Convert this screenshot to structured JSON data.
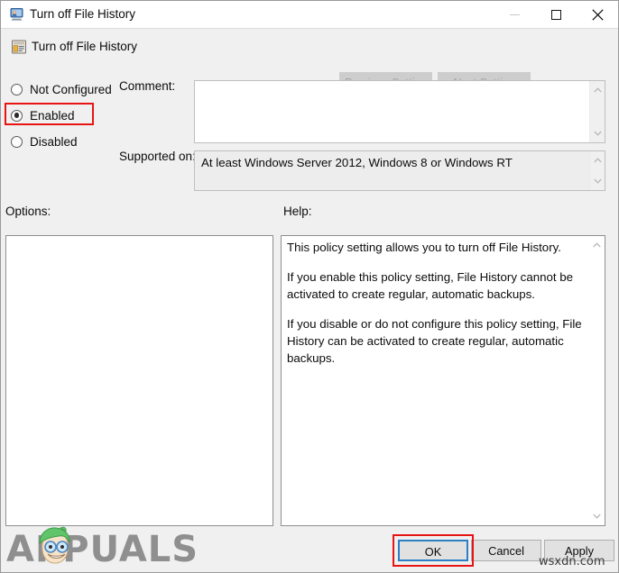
{
  "window": {
    "title": "Turn off File History",
    "icon": "policy-monitor-icon",
    "controls": {
      "minimize": "minimize-icon",
      "maximize": "maximize-icon",
      "close": "close-icon"
    }
  },
  "header": {
    "title": "Turn off File History",
    "icon": "group-policy-setting-icon",
    "previous_setting_label": "Previous Setting",
    "next_setting_label": "Next Setting",
    "previous_setting_enabled": false,
    "next_setting_enabled": false
  },
  "state_options": {
    "selected": "Enabled",
    "items": [
      {
        "label": "Not Configured",
        "checked": false
      },
      {
        "label": "Enabled",
        "checked": true
      },
      {
        "label": "Disabled",
        "checked": false
      }
    ]
  },
  "comment": {
    "label": "Comment:",
    "value": "",
    "placeholder": ""
  },
  "supported_on": {
    "label": "Supported on:",
    "value": "At least Windows Server 2012, Windows 8 or Windows RT"
  },
  "options": {
    "label": "Options:",
    "items": []
  },
  "help": {
    "label": "Help:",
    "paragraphs": [
      "This policy setting allows you to turn off File History.",
      "If you enable this policy setting, File History cannot be activated to create regular, automatic backups.",
      "If you disable or do not configure this policy setting, File History can be activated to create regular, automatic backups."
    ]
  },
  "footer": {
    "ok_label": "OK",
    "cancel_label": "Cancel",
    "apply_label": "Apply"
  },
  "annotations": {
    "color": "#e81414",
    "targets": [
      "Enabled",
      "OK"
    ]
  },
  "watermarks": {
    "brand": "APPUALS",
    "site": "wsxdn.com"
  },
  "colors": {
    "window_background": "#f0f0f0",
    "titlebar_background": "#ffffff",
    "field_background": "#ffffff",
    "disabled_button": "#cdcdcd",
    "disabled_text": "#a6a6a6",
    "focus_border": "#2c7fc4",
    "annotation_red": "#e81414",
    "text": "#0b0b0b"
  }
}
